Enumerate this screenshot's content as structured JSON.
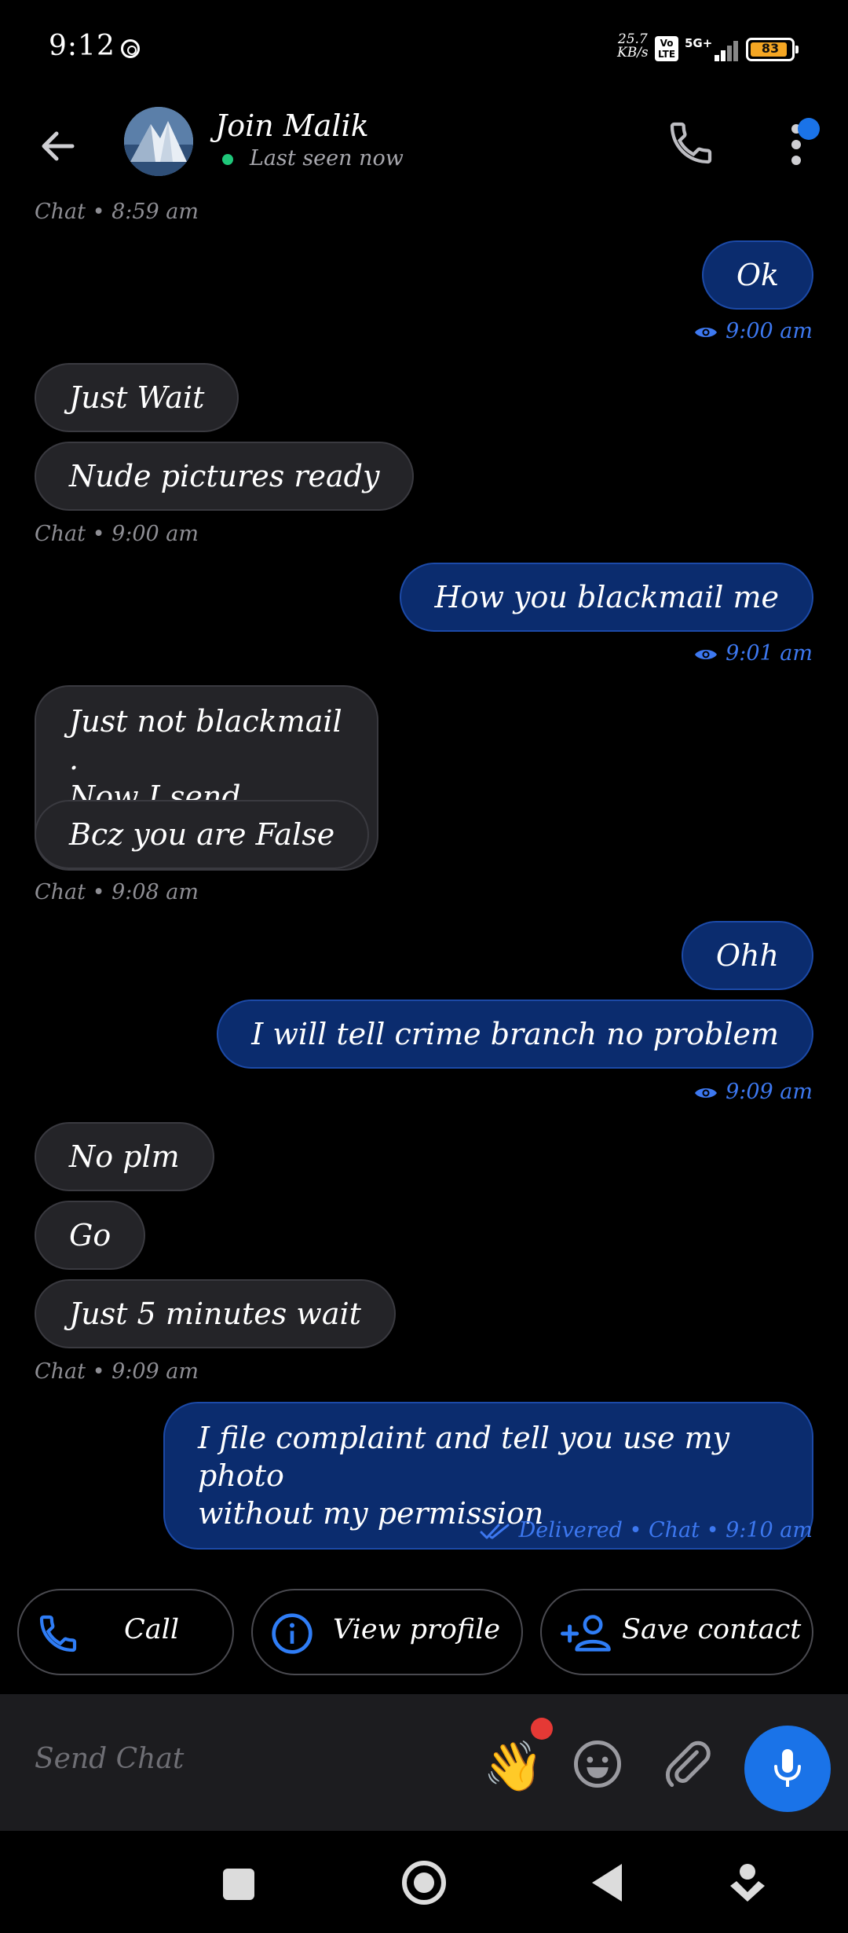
{
  "status_bar": {
    "time": "9:12",
    "net_speed_value": "25.7",
    "net_speed_unit": "KB/s",
    "volte": "Vo LTE",
    "network": "5G+",
    "battery": "83"
  },
  "header": {
    "contact_name": "Join Malik",
    "last_seen": "Last seen now"
  },
  "messages": [
    {
      "type": "meta",
      "side": "left",
      "text": "Chat • 8:59 am"
    },
    {
      "type": "bubble",
      "side": "out",
      "text": "Ok"
    },
    {
      "type": "meta",
      "side": "right",
      "text": "9:00 am",
      "icon": "eye-icon"
    },
    {
      "type": "bubble",
      "side": "in",
      "text": "Just Wait"
    },
    {
      "type": "bubble",
      "side": "in",
      "text": "Nude pictures ready"
    },
    {
      "type": "meta",
      "side": "left",
      "text": "Chat • 9:00 am"
    },
    {
      "type": "bubble",
      "side": "out",
      "text": "How you blackmail me"
    },
    {
      "type": "meta",
      "side": "right",
      "text": "9:01 am",
      "icon": "eye-icon"
    },
    {
      "type": "bubble",
      "side": "in",
      "line1": "Just not blackmail .",
      "line2": "Now I send everyone"
    },
    {
      "type": "bubble",
      "side": "in",
      "text": "Bcz you are False"
    },
    {
      "type": "meta",
      "side": "left",
      "text": "Chat • 9:08 am"
    },
    {
      "type": "bubble",
      "side": "out",
      "text": "Ohh"
    },
    {
      "type": "bubble",
      "side": "out",
      "text": "I will tell crime branch no problem"
    },
    {
      "type": "meta",
      "side": "right",
      "text": "9:09 am",
      "icon": "eye-icon"
    },
    {
      "type": "bubble",
      "side": "in",
      "text": "No plm"
    },
    {
      "type": "bubble",
      "side": "in",
      "text": "Go"
    },
    {
      "type": "bubble",
      "side": "in",
      "text": "Just 5 minutes wait"
    },
    {
      "type": "meta",
      "side": "left",
      "text": "Chat • 9:09 am"
    },
    {
      "type": "bubble",
      "side": "out",
      "line1": "I file complaint and tell you use my photo",
      "line2": "without my permission"
    },
    {
      "type": "meta",
      "side": "right",
      "text": "Delivered • Chat • 9:10 am",
      "icon": "double-check-icon"
    }
  ],
  "quick_actions": {
    "call": "Call",
    "view_profile": "View profile",
    "save_contact": "Save contact"
  },
  "composer": {
    "placeholder": "Send Chat",
    "wave_emoji": "👋"
  },
  "colors": {
    "accent": "#1a73e8",
    "outgoing_bubble": "#0b2c6e",
    "incoming_bubble": "#242428",
    "meta_blue": "#3d78f0"
  }
}
